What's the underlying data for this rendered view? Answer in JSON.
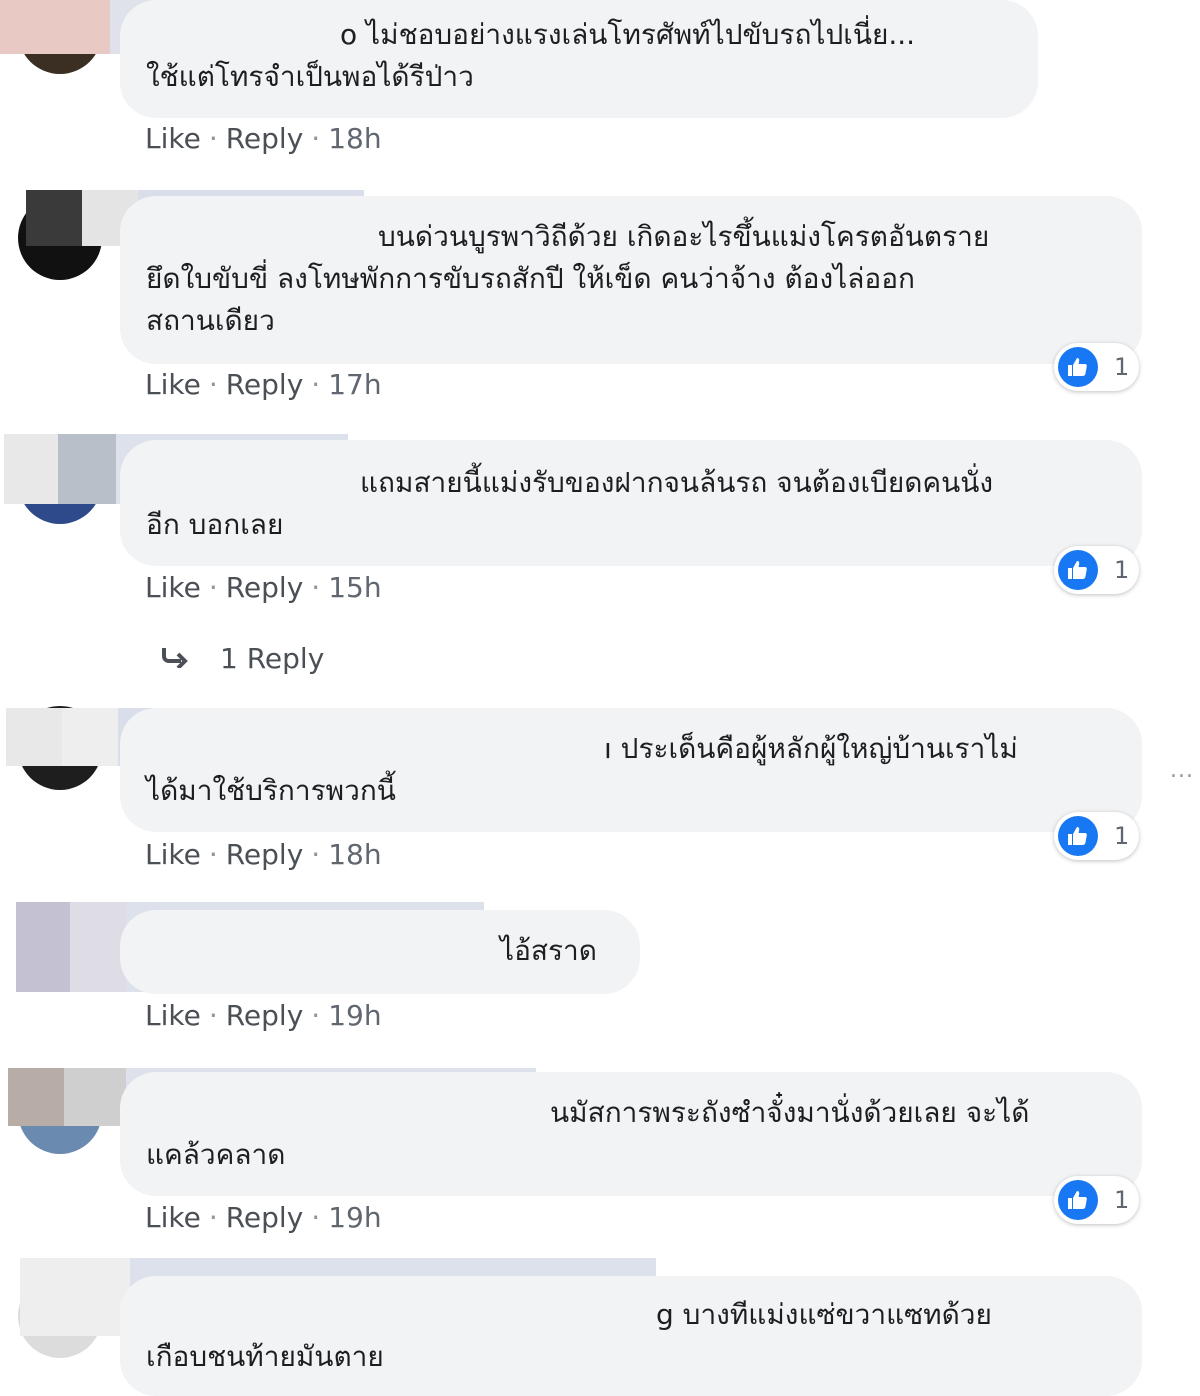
{
  "comments": [
    {
      "lines": [
        "o ไม่ชอบอย่างแรงเล่นโทรศัพท์ไปขับรถไปเนี่ย...",
        "ใช้แต่โทรจำเป็นพอได้รีป่าว"
      ],
      "actions": {
        "like": "Like",
        "reply": "Reply",
        "time": "18h"
      }
    },
    {
      "lines": [
        "บนด่วนบูรพาวิถีด้วย เกิดอะไรขึ้นแม่งโครตอันตราย",
        "ยึดใบขับขี่ ลงโทษพักการขับรถสักปี ให้เข็ด คนว่าจ้าง ต้องไล่ออก",
        "สถานเดียว"
      ],
      "actions": {
        "like": "Like",
        "reply": "Reply",
        "time": "17h"
      },
      "reaction_count": "1"
    },
    {
      "lines": [
        "แถมสายนี้แม่งรับของฝากจนล้นรถ จนต้องเบียดคนนั่ง",
        "อีก บอกเลย"
      ],
      "actions": {
        "like": "Like",
        "reply": "Reply",
        "time": "15h"
      },
      "reaction_count": "1",
      "replies_label": "1 Reply"
    },
    {
      "lines": [
        "ı ประเด็นคือผู้หลักผู้ใหญ่บ้านเราไม่",
        "ได้มาใช้บริการพวกนี้"
      ],
      "actions": {
        "like": "Like",
        "reply": "Reply",
        "time": "18h"
      },
      "reaction_count": "1"
    },
    {
      "lines": [
        "ไอ้สราด"
      ],
      "actions": {
        "like": "Like",
        "reply": "Reply",
        "time": "19h"
      }
    },
    {
      "lines": [
        "นมัสการพระถังซำจั๋งมานั่งด้วยเลย จะได้",
        "แคล้วคลาด"
      ],
      "actions": {
        "like": "Like",
        "reply": "Reply",
        "time": "19h"
      },
      "reaction_count": "1"
    },
    {
      "lines": [
        "g บางทีแม่งแซ่ขวาแซทด้วย",
        "เกือบชนท้ายมันตาย"
      ]
    }
  ],
  "icons": {
    "like_badge": "thumbs-up-icon",
    "reply_arrow": "reply-arrow-icon",
    "more": "more-options-icon"
  },
  "colors": {
    "bubble": "#f2f3f5",
    "like_blue": "#1877f2",
    "meta_text": "#606770"
  },
  "more_options": "..."
}
